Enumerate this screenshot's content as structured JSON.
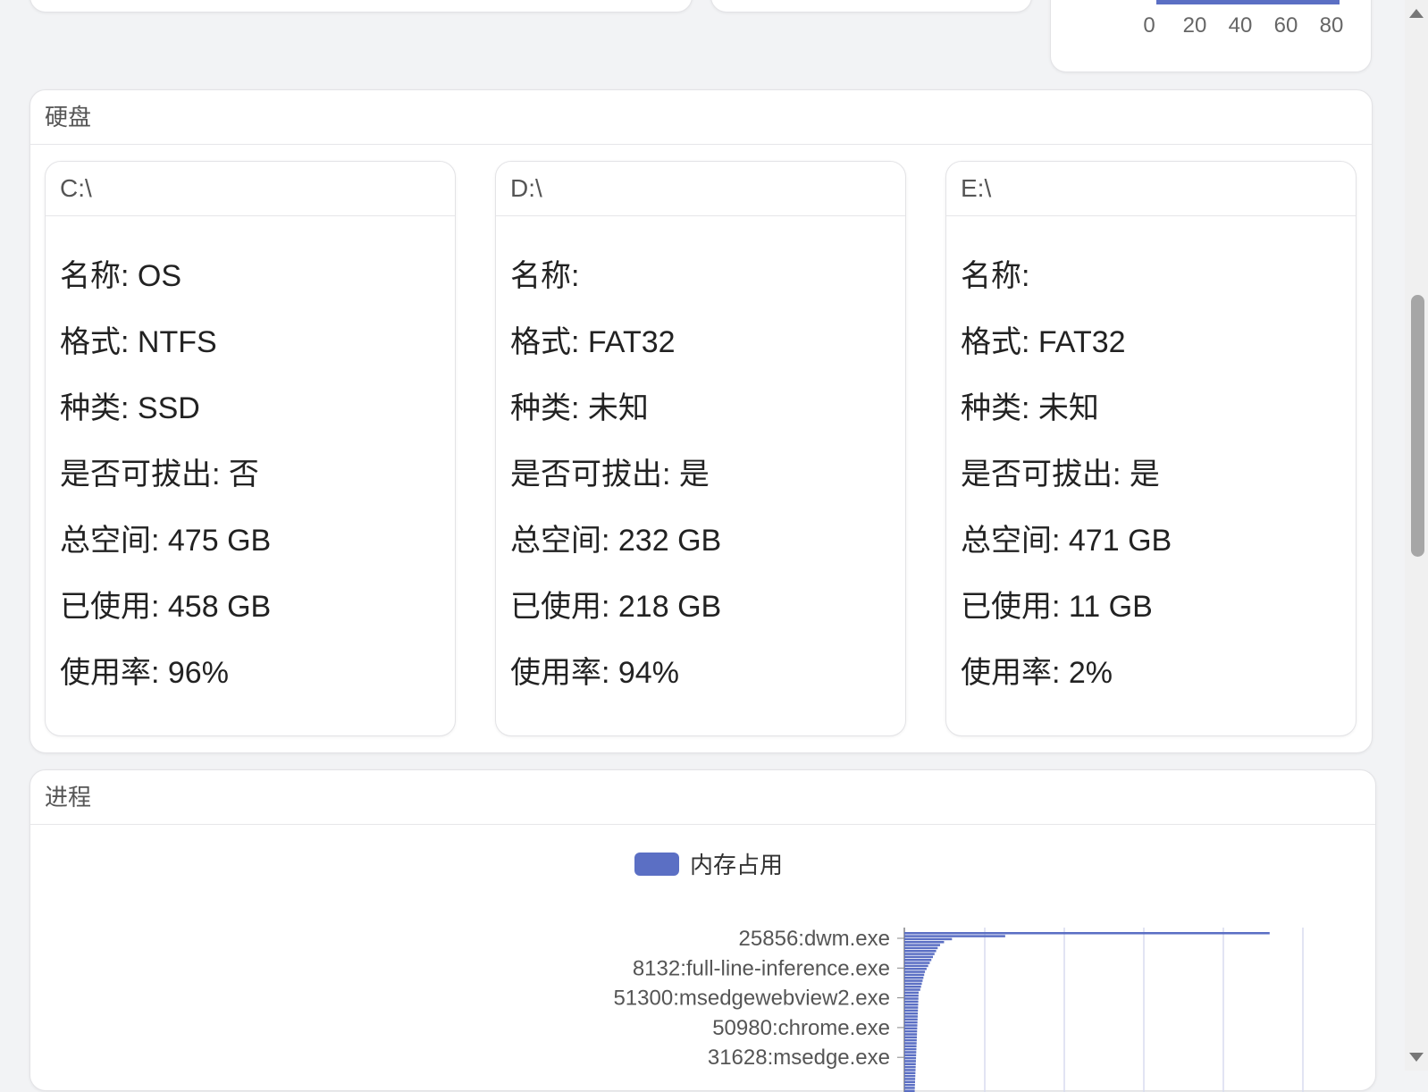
{
  "top_axis": {
    "ticks": [
      "0",
      "20",
      "40",
      "60",
      "80"
    ]
  },
  "disk_panel": {
    "title": "硬盘",
    "disks": [
      {
        "drive": "C:\\",
        "name": "名称: OS",
        "format": "格式: NTFS",
        "kind": "种类: SSD",
        "removable": "是否可拔出: 否",
        "total": "总空间: 475 GB",
        "used": "已使用: 458 GB",
        "usage": "使用率: 96%"
      },
      {
        "drive": "D:\\",
        "name": "名称:",
        "format": "格式: FAT32",
        "kind": "种类: 未知",
        "removable": "是否可拔出: 是",
        "total": "总空间: 232 GB",
        "used": "已使用: 218 GB",
        "usage": "使用率: 94%"
      },
      {
        "drive": "E:\\",
        "name": "名称:",
        "format": "格式: FAT32",
        "kind": "种类: 未知",
        "removable": "是否可拔出: 是",
        "total": "总空间: 471 GB",
        "used": "已使用: 11 GB",
        "usage": "使用率: 2%"
      }
    ]
  },
  "process_panel": {
    "title": "进程",
    "legend": "内存占用",
    "accent_color": "#5b6fc4"
  },
  "chart_data": {
    "type": "bar",
    "orientation": "horizontal",
    "series": [
      {
        "name": "内存占用",
        "values": [
          460,
          127,
          60,
          50,
          45,
          42,
          40,
          38,
          36,
          34,
          32,
          30,
          28,
          26,
          25,
          24,
          23,
          22,
          21,
          20
        ]
      }
    ],
    "categories": [
      "25856:dwm.exe",
      "",
      "",
      "",
      "",
      "",
      "",
      "",
      "",
      "",
      "8132:full-line-inference.exe",
      "",
      "",
      "",
      "",
      "",
      "",
      "",
      "",
      "",
      "51300:msedgewebview2.exe",
      "",
      "",
      "",
      "",
      "",
      "",
      "",
      "",
      "",
      "50980:chrome.exe",
      "",
      "",
      "",
      "",
      "",
      "",
      "",
      "",
      "",
      "31628:msedge.exe"
    ],
    "tick_labels": [
      "25856:dwm.exe",
      "8132:full-line-inference.exe",
      "51300:msedgewebview2.exe",
      "50980:chrome.exe",
      "31628:msedge.exe"
    ],
    "legend_position": "top-center",
    "grid": true
  }
}
